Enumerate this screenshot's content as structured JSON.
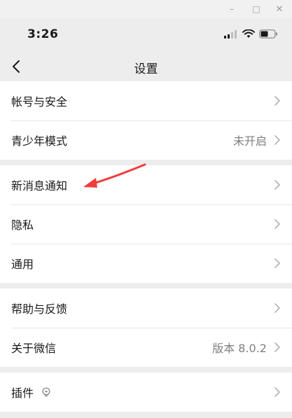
{
  "window": {
    "minimize_label": "–",
    "maximize_label": "□",
    "close_label": "✕"
  },
  "status_bar": {
    "time": "3:26",
    "icons": [
      "signal-icon",
      "wifi-icon",
      "battery-icon"
    ]
  },
  "nav": {
    "title": "设置",
    "back_icon": "chevron-left-icon"
  },
  "groups": [
    {
      "items": [
        {
          "label": "帐号与安全",
          "value": ""
        },
        {
          "label": "青少年模式",
          "value": "未开启"
        }
      ]
    },
    {
      "items": [
        {
          "label": "新消息通知",
          "value": ""
        },
        {
          "label": "隐私",
          "value": ""
        },
        {
          "label": "通用",
          "value": ""
        }
      ]
    },
    {
      "items": [
        {
          "label": "帮助与反馈",
          "value": ""
        },
        {
          "label": "关于微信",
          "value": "版本 8.0.2"
        }
      ]
    },
    {
      "items": [
        {
          "label": "插件",
          "value": "",
          "icon": "lightbulb-icon"
        }
      ]
    }
  ],
  "colors": {
    "background": "#ededed",
    "card": "#ffffff",
    "annotation_arrow": "#f23c3c",
    "secondary_text": "#7f7f7f"
  }
}
